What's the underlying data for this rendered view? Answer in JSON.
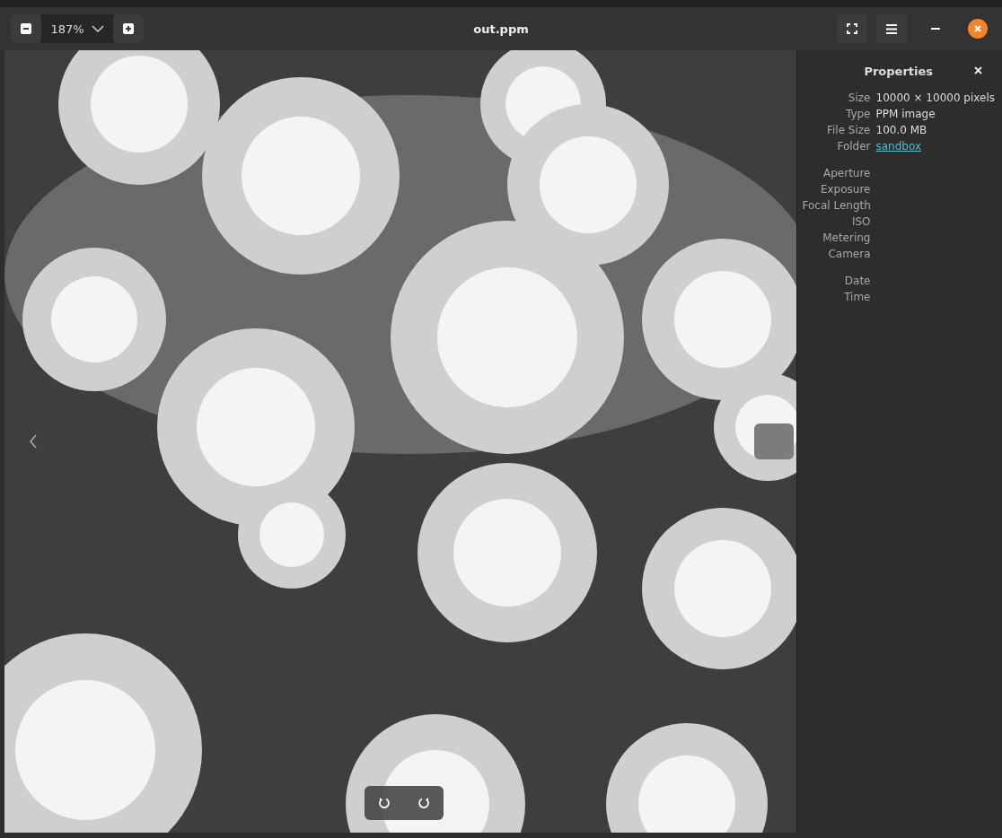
{
  "window": {
    "title": "out.ppm"
  },
  "zoom": {
    "value": "187%"
  },
  "properties": {
    "title": "Properties",
    "groups": [
      {
        "rows": [
          {
            "label": "Size",
            "value": "10000 × 10000 pixels",
            "kind": "text"
          },
          {
            "label": "Type",
            "value": "PPM image",
            "kind": "text"
          },
          {
            "label": "File Size",
            "value": "100.0 MB",
            "kind": "text"
          },
          {
            "label": "Folder",
            "value": "sandbox",
            "kind": "link"
          }
        ]
      },
      {
        "rows": [
          {
            "label": "Aperture"
          },
          {
            "label": "Exposure"
          },
          {
            "label": "Focal Length"
          },
          {
            "label": "ISO"
          },
          {
            "label": "Metering"
          },
          {
            "label": "Camera"
          }
        ]
      },
      {
        "rows": [
          {
            "label": "Date"
          },
          {
            "label": "Time"
          }
        ]
      }
    ]
  }
}
